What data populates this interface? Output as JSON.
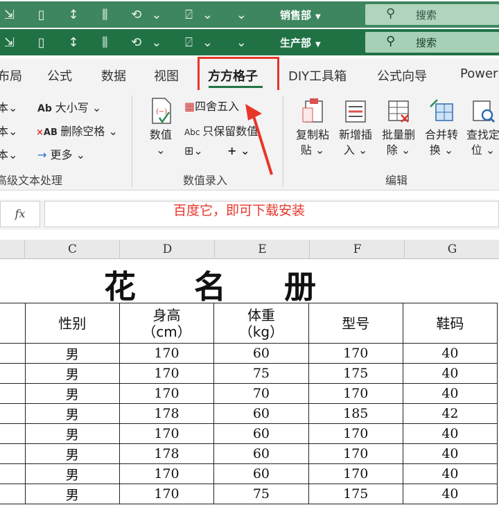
{
  "title_bar_back": {
    "department": "销售部",
    "search": "搜索"
  },
  "title_bar_front": {
    "department": "生产部",
    "search": "搜索"
  },
  "tabs": [
    {
      "label": "布局"
    },
    {
      "label": "公式"
    },
    {
      "label": "数据"
    },
    {
      "label": "视图"
    },
    {
      "label": "方方格子"
    },
    {
      "label": "DIY工具箱"
    },
    {
      "label": "公式向导"
    },
    {
      "label": "Power"
    }
  ],
  "ribbon": {
    "text_group": {
      "case": "大小写",
      "remove_spaces": "删除空格",
      "more": "更多",
      "label": "高级文本处理"
    },
    "numeric_group": {
      "value_button": "数值",
      "round": "四舍五入",
      "keep_numbers": "只保留数值",
      "label": "数值录入"
    },
    "edit_group": {
      "copy_paste": [
        "复制粘",
        "贴"
      ],
      "insert": [
        "新增插",
        "入"
      ],
      "batch_delete": [
        "批量删",
        "除"
      ],
      "merge_convert": [
        "合并转",
        "换"
      ],
      "find_locate": [
        "查找定",
        "位"
      ],
      "label": "编辑"
    }
  },
  "annotation": "百度它，即可下载安装",
  "formula_bar": {
    "fx": "fx"
  },
  "columns": [
    "C",
    "D",
    "E",
    "F",
    "G"
  ],
  "sheet": {
    "title": "花名册",
    "headers": [
      "性别",
      "身高",
      "体重",
      "型号",
      "鞋码"
    ],
    "header_units": [
      "",
      "（cm）",
      "（kg）",
      "",
      ""
    ],
    "rows": [
      [
        "男",
        "170",
        "60",
        "170",
        "40"
      ],
      [
        "男",
        "170",
        "75",
        "175",
        "40"
      ],
      [
        "男",
        "170",
        "70",
        "170",
        "40"
      ],
      [
        "男",
        "178",
        "60",
        "185",
        "42"
      ],
      [
        "男",
        "170",
        "60",
        "170",
        "40"
      ],
      [
        "男",
        "178",
        "60",
        "170",
        "40"
      ],
      [
        "男",
        "170",
        "60",
        "170",
        "40"
      ],
      [
        "男",
        "170",
        "75",
        "175",
        "40"
      ]
    ]
  }
}
